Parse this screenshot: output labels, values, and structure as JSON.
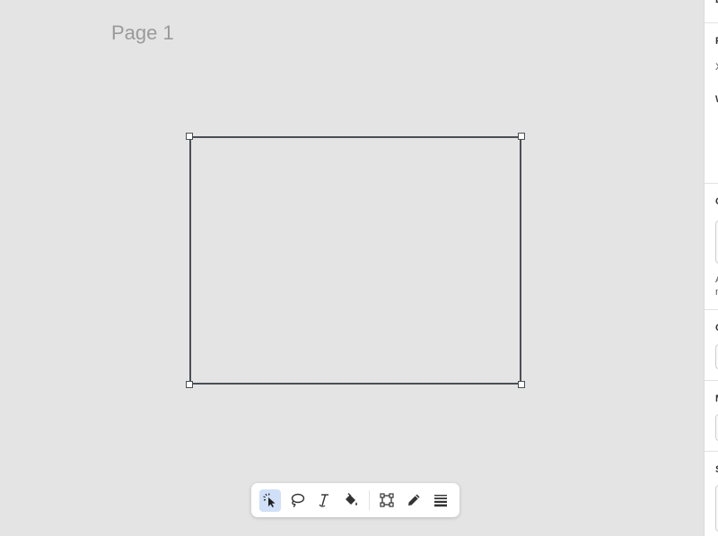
{
  "canvas": {
    "page_label": "Page 1"
  },
  "toolbar": {
    "tools": [
      {
        "name": "select",
        "icon": "select-pointer-icon",
        "active": true
      },
      {
        "name": "lasso",
        "icon": "lasso-icon",
        "active": false
      },
      {
        "name": "text",
        "icon": "text-cursor-icon",
        "active": false
      },
      {
        "name": "fill",
        "icon": "paint-bucket-icon",
        "active": false
      },
      {
        "name": "frame",
        "icon": "frame-icon",
        "active": false
      },
      {
        "name": "pencil",
        "icon": "pencil-icon",
        "active": false
      },
      {
        "name": "lines",
        "icon": "lines-icon",
        "active": false
      }
    ]
  },
  "right_panel": {
    "section_initials": [
      "L",
      "P",
      "X",
      "W",
      "C",
      "A",
      "n",
      "C",
      "M",
      "S"
    ]
  },
  "colors": {
    "canvas_bg": "#e4e4e4",
    "frame_stroke": "#4a4f55",
    "active_tool_bg": "#cfe0f8",
    "panel_bg": "#ffffff"
  }
}
